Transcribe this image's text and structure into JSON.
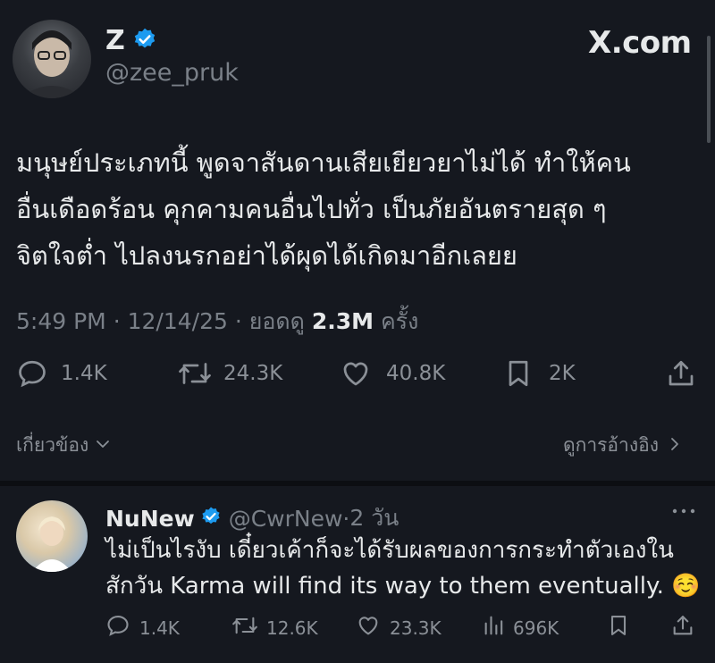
{
  "brand": {
    "label": "X.com"
  },
  "post": {
    "author_name": "Z",
    "author_handle": "@zee_pruk",
    "lines": [
      "มนุษย์ประเภทนี้ พูดจาสันดานเสียเยียวยาไม่ได้ ทำให้คน",
      "อื่นเดือดร้อน คุกคามคนอื่นไปทั่ว เป็นภัยอันตรายสุด ๆ",
      "จิตใจต่ำ ไปลงนรกอย่าได้ผุดได้เกิดมาอีกเลยย"
    ],
    "time": "5:49 PM",
    "date": "12/14/25",
    "views_label": "ยอดดู",
    "views_value": "2.3M",
    "views_suffix": "ครั้ง",
    "replies": "1.4K",
    "reposts": "24.3K",
    "likes": "40.8K",
    "bookmarks": "2K"
  },
  "related": {
    "label": "เกี่ยวข้อง",
    "view_quotes": "ดูการอ้างอิง"
  },
  "reply": {
    "author_name": "NuNew",
    "author_handle": "@CwrNew",
    "age": "2 วัน",
    "lines": [
      "ไม่เป็นไรงับ เดี๋ยวเค้าก็จะได้รับผลของการกระทำตัวเองใน",
      "สักวัน Karma will find its way to them eventually. ☺️"
    ],
    "replies": "1.4K",
    "reposts": "12.6K",
    "likes": "23.3K",
    "views": "696K"
  },
  "colors": {
    "background": "#15181f",
    "verified": "#1d9bf0",
    "muted": "#7a8088",
    "text": "#e7e9ea"
  }
}
